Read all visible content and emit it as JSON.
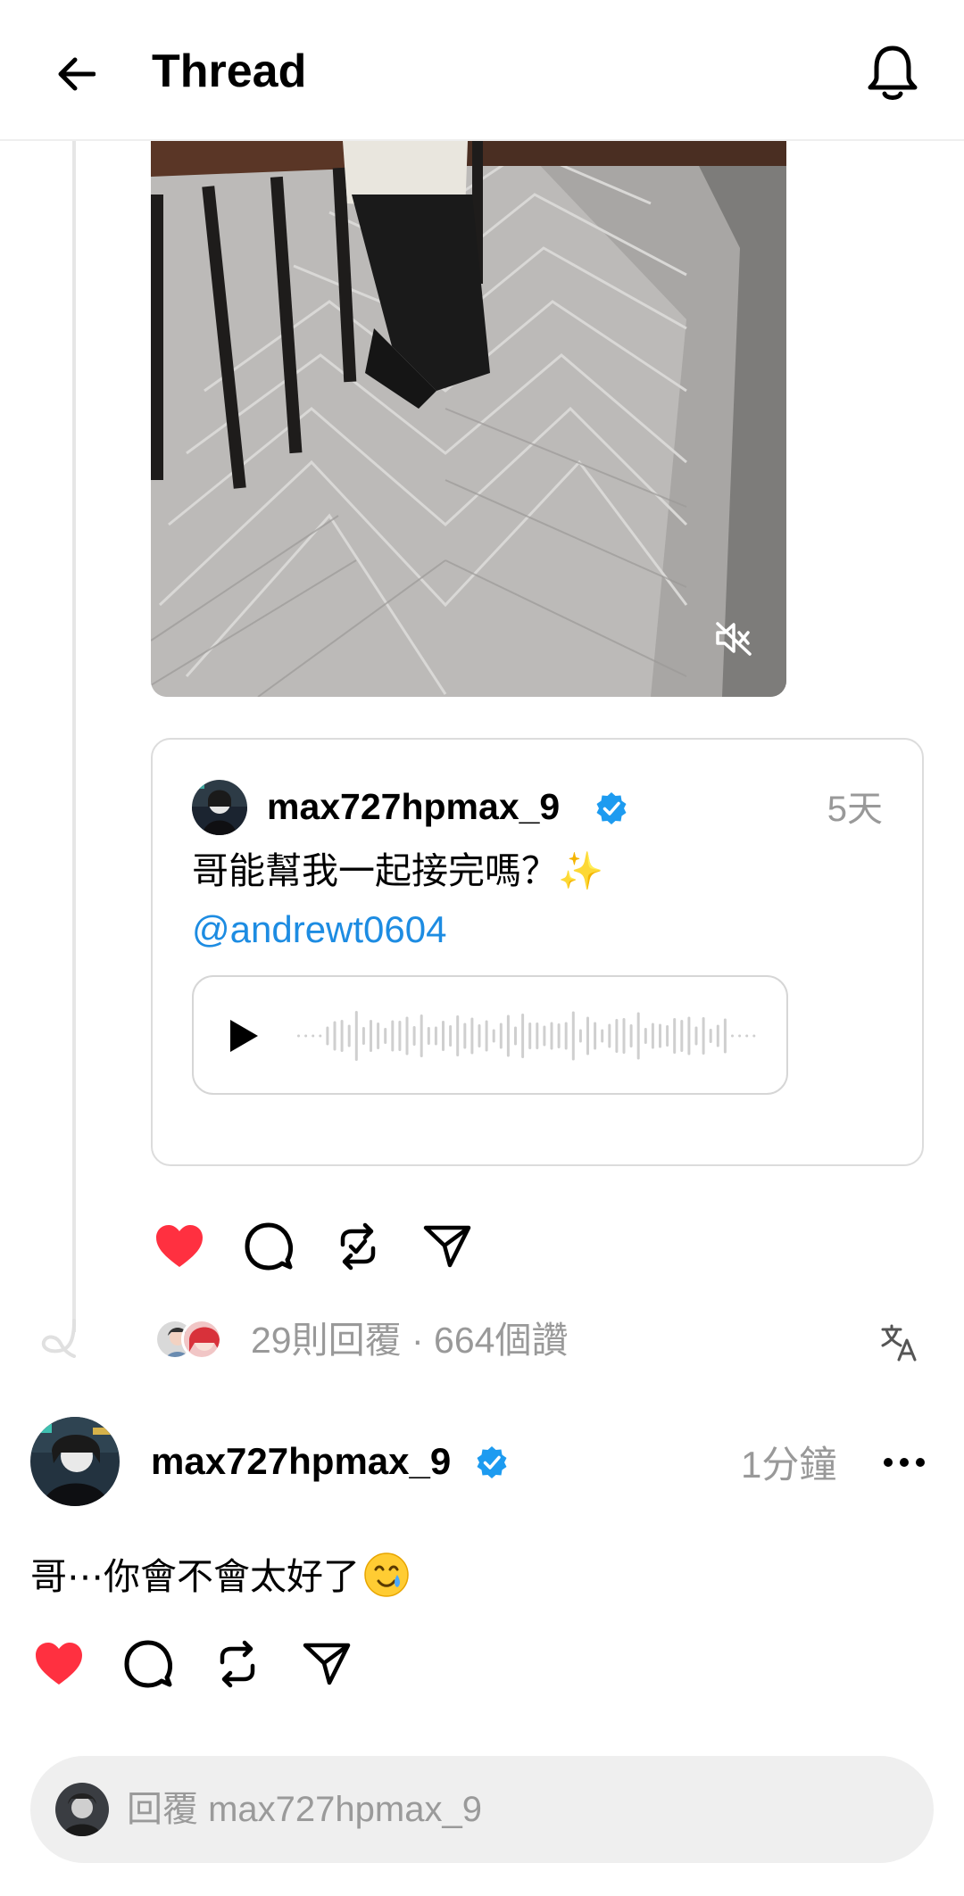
{
  "header": {
    "title": "Thread",
    "back_icon": "arrow-left-icon",
    "bell_icon": "bell-icon"
  },
  "media": {
    "type": "video",
    "muted": true,
    "mute_icon": "speaker-muted-icon"
  },
  "quoted_post": {
    "username": "max727hpmax_9",
    "verified": true,
    "time": "5天",
    "text": "哥能幫我一起接完嗎？✨",
    "mention": "@andrewt0604",
    "audio": {
      "play_icon": "play-icon",
      "waveform_icon": "waveform-icon"
    }
  },
  "post_actions": {
    "like_icon": "heart-filled-icon",
    "liked": true,
    "comment_icon": "comment-icon",
    "repost_icon": "repost-icon",
    "share_icon": "send-icon"
  },
  "stats": {
    "text": "29則回覆 · 664個讚",
    "translate_icon": "translate-icon"
  },
  "reply_post": {
    "username": "max727hpmax_9",
    "verified": true,
    "time": "1分鐘",
    "text": "哥⋯你會不會太好了",
    "emoji": "crying-smile-emoji",
    "more_icon": "more-horizontal-icon",
    "actions": {
      "like_icon": "heart-filled-icon",
      "liked": true,
      "comment_icon": "comment-icon",
      "repost_icon": "repost-icon",
      "share_icon": "send-icon"
    }
  },
  "reply_bar": {
    "placeholder": "回覆 max727hpmax_9"
  },
  "colors": {
    "heart": "#ff3040",
    "verified": "#1d9bf0",
    "mention": "#1d8ce2",
    "muted_text": "#999999",
    "reply_bar_bg": "#efefef"
  }
}
